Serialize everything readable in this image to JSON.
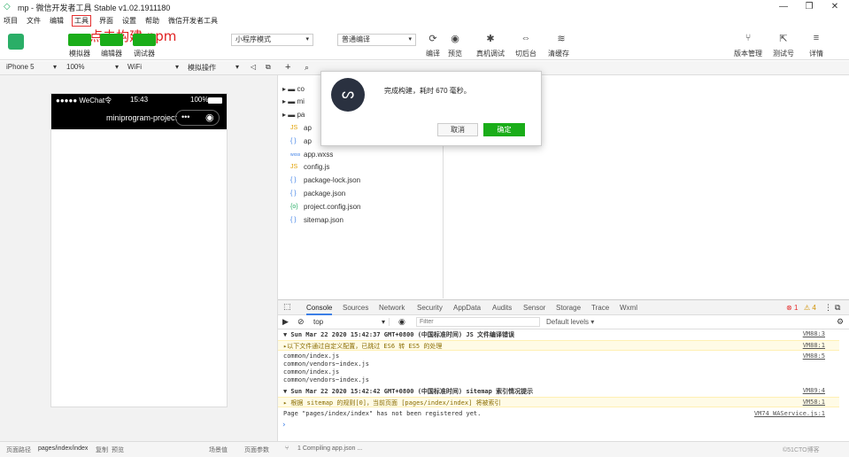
{
  "window": {
    "title": "mp - 微信开发者工具 Stable v1.02.1911180",
    "controls": [
      "—",
      "❐",
      "✕"
    ]
  },
  "menubar": [
    "项目",
    "文件",
    "编辑",
    "工具",
    "界面",
    "设置",
    "帮助",
    "微信开发者工具"
  ],
  "annotation": "点击构建 npm",
  "toolbar": {
    "simulator": "模拟器",
    "editor": "编辑器",
    "debugger": "调试器",
    "mode_select": "小程序模式",
    "compile_select": "普通编译",
    "compile": "编译",
    "preview": "预览",
    "real_debug": "真机调试",
    "background": "切后台",
    "clear_cache": "清缓存",
    "version": "版本管理",
    "test": "测试号",
    "details": "详情"
  },
  "devicebar": {
    "device": "iPhone 5",
    "zoom": "100%",
    "network": "WiFi",
    "operation": "模拟操作"
  },
  "phone": {
    "carrier": "●●●●● WeChat令",
    "time": "15:43",
    "battery": "100%",
    "nav_title": "miniprogram-project"
  },
  "filetree": {
    "folders": [
      "co",
      "mi",
      "pa"
    ],
    "files": [
      {
        "icon": "JS",
        "name": "ap"
      },
      {
        "icon": "{ }",
        "name": "ap"
      },
      {
        "icon": "wxss",
        "name": "app.wxss"
      },
      {
        "icon": "JS",
        "name": "config.js"
      },
      {
        "icon": "{ }",
        "name": "package-lock.json"
      },
      {
        "icon": "{ }",
        "name": "package.json"
      },
      {
        "icon": "{o}",
        "name": "project.config.json"
      },
      {
        "icon": "{ }",
        "name": "sitemap.json"
      }
    ]
  },
  "dialog": {
    "message": "完成构建，耗时 670 毫秒。",
    "cancel": "取消",
    "ok": "确定"
  },
  "devtools": {
    "tabs": [
      "Console",
      "Sources",
      "Network",
      "Security",
      "AppData",
      "Audits",
      "Sensor",
      "Storage",
      "Trace",
      "Wxml"
    ],
    "errors": "1",
    "warnings": "4",
    "context": "top",
    "filter_placeholder": "Filter",
    "levels": "Default levels ▾"
  },
  "console": {
    "lines": [
      {
        "text": "▼ Sun Mar 22 2020 15:42:37 GMT+0800 (中国标准时间) JS 文件编译错误",
        "link": "VM88:3"
      },
      {
        "text": "  ▸以下文件通过自定义配置，已跳过 ES6 转 ES5 的处理",
        "link": "VM88:1"
      },
      {
        "text": "    common/index.js",
        "link": "VM88:5"
      },
      {
        "text": "    common/vendors~index.js",
        "link": ""
      },
      {
        "text": "    common/index.js",
        "link": ""
      },
      {
        "text": "    common/vendors~index.js",
        "link": ""
      },
      {
        "text": "▼ Sun Mar 22 2020 15:42:42 GMT+0800 (中国标准时间) sitemap 索引情况提示",
        "link": "VM89:4"
      },
      {
        "text": "  ▸ 根据 sitemap 的规则[0]，当前页面 [pages/index/index] 将被索引",
        "link": "VM58:1"
      },
      {
        "text": "  Page \"pages/index/index\" has not been registered yet.",
        "link": "VM74 WAService.js:1"
      }
    ]
  },
  "statusbar": {
    "path_label": "页面路径",
    "path": "pages/index/index",
    "copy": "复制",
    "preview": "预览",
    "scene": "场景值",
    "params": "页面参数",
    "compiling": "1 Compiling app.json ...",
    "watermark": "©51CTO博客"
  }
}
